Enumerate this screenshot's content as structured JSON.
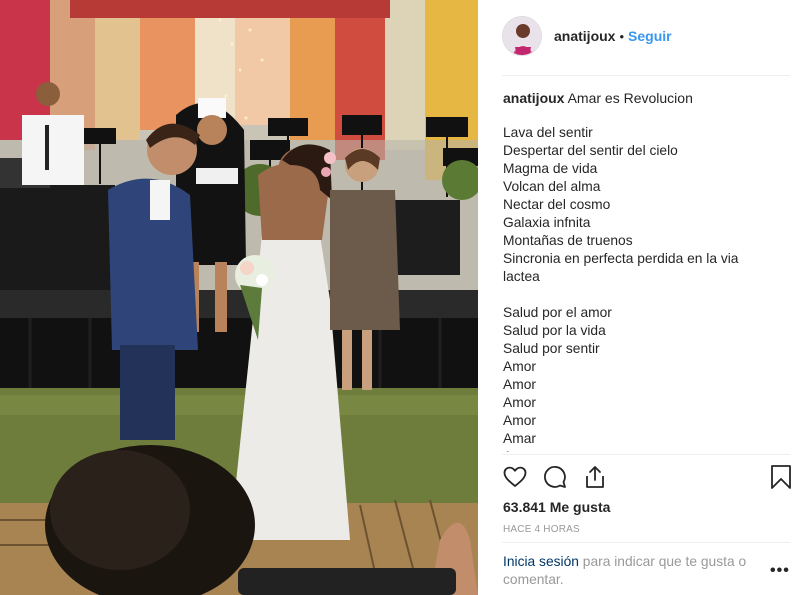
{
  "post": {
    "username": "anatijoux",
    "dot": "•",
    "follow_label": "Seguir",
    "caption_title": "Amar es Revolucion",
    "caption_body": "Lava del sentir\nDespertar del sentir del cielo\nMagma de vida\nVolcan del alma\nNectar del cosmo\nGalaxia infnita\nMontañas de truenos\nSincronia en perfecta perdida en la via lactea\n\nSalud por el amor\nSalud por la vida\nSalud por sentir\nAmor\nAmor\nAmor\nAmor\nAmar\nAmor",
    "likes": "63.841 Me gusta",
    "timestamp": "HACE 4 HORAS",
    "login_link": "Inicia sesión",
    "login_text": " para indicar que te gusta o comentar.",
    "more_label": "•••"
  },
  "icons": {
    "like": "heart-icon",
    "comment": "comment-icon",
    "share": "share-icon",
    "save": "bookmark-icon",
    "more": "more-options-icon"
  },
  "colors": {
    "link": "#3897f0",
    "login_link": "#003569",
    "muted": "#999999",
    "text": "#262626"
  }
}
